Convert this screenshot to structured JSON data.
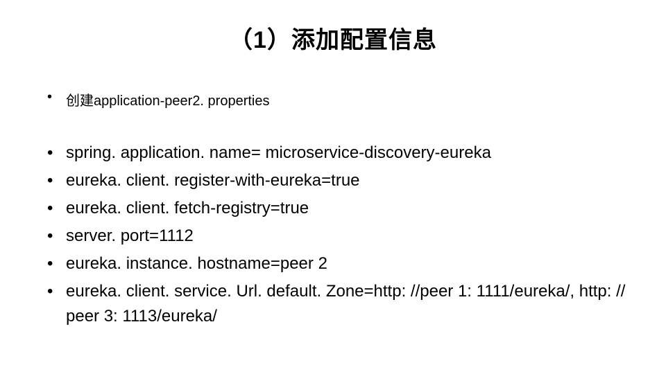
{
  "title": "（1）添加配置信息",
  "intro": {
    "item1": "创建application-peer2. properties"
  },
  "config": {
    "line1": "spring. application. name= microservice-discovery-eureka",
    "line2": "eureka. client. register-with-eureka=true",
    "line3": "eureka. client. fetch-registry=true",
    "line4": "server. port=1112",
    "line5": "eureka. instance. hostname=peer 2",
    "line6": "eureka. client. service. Url. default. Zone=http: //peer 1: 1111/eureka/, http: // peer 3: 1113/eureka/"
  }
}
